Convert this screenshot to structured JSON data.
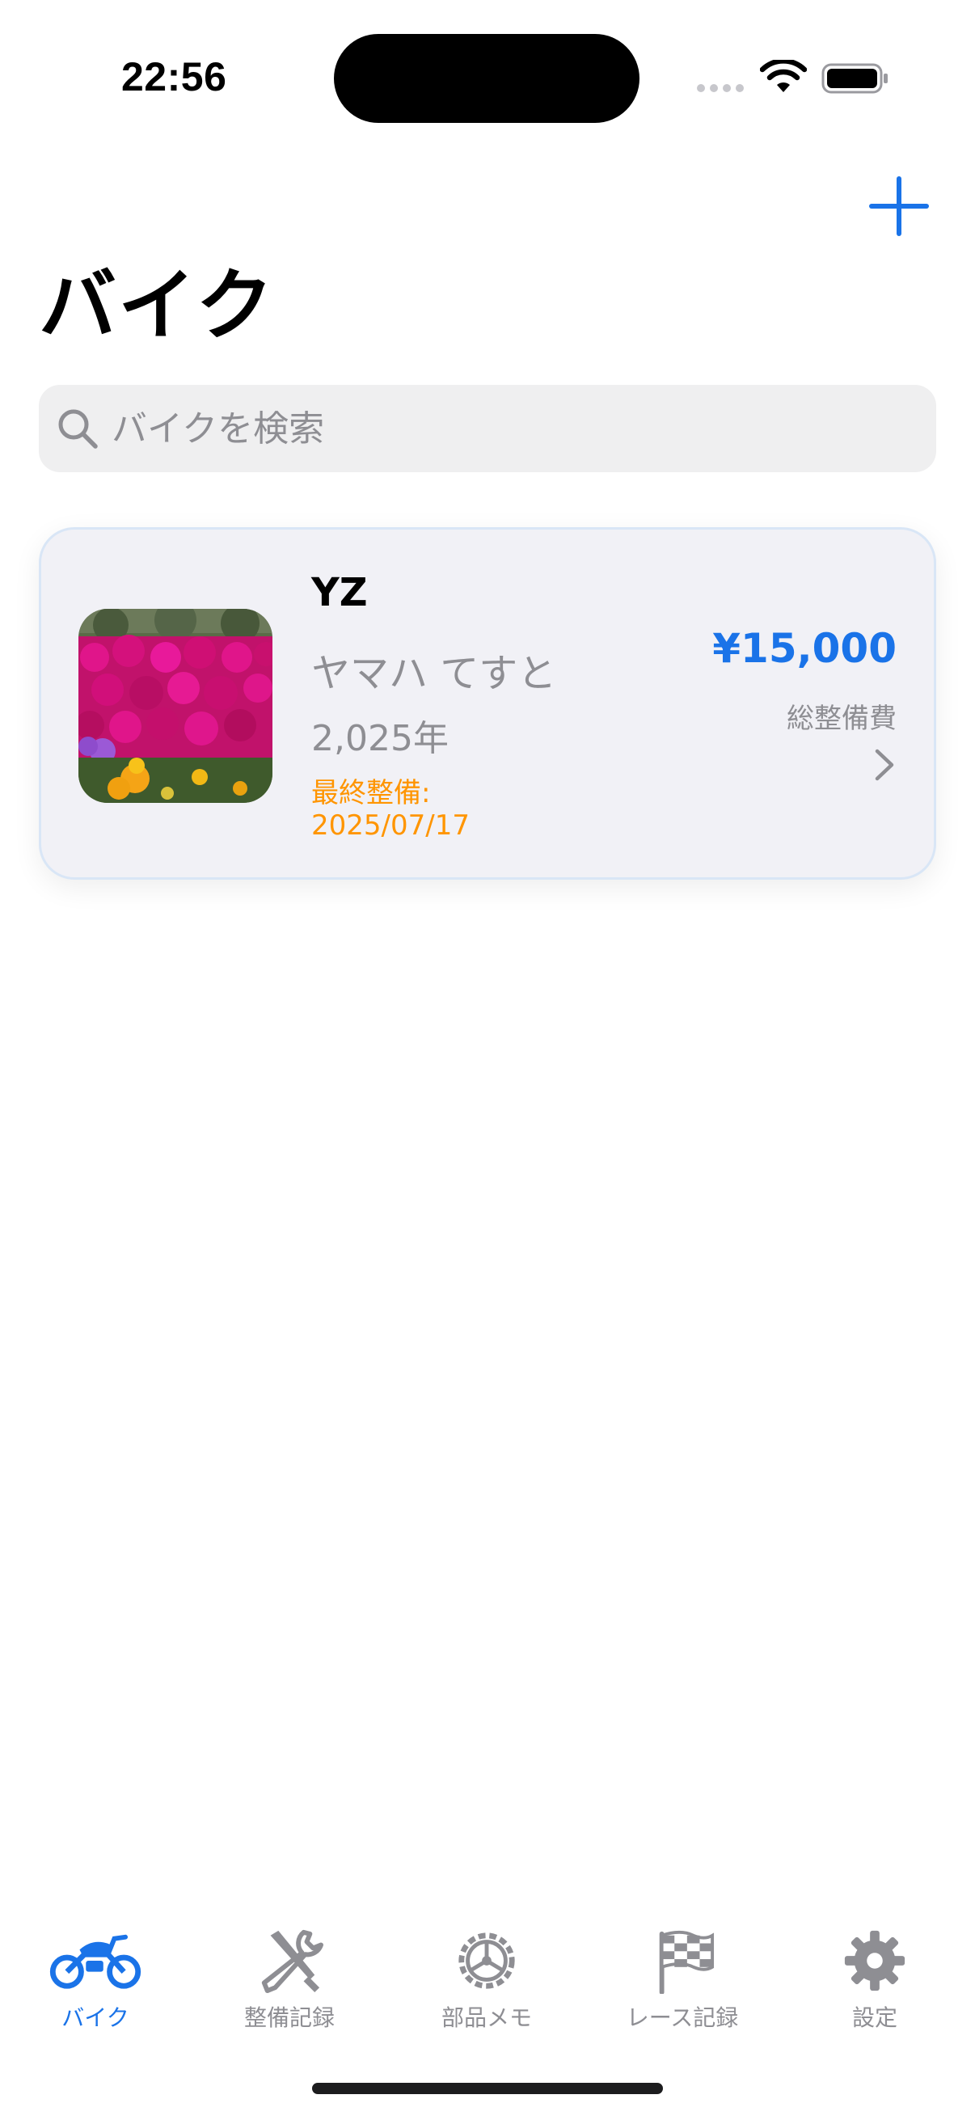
{
  "status_bar": {
    "time": "22:56"
  },
  "nav": {
    "title": "バイク"
  },
  "search": {
    "placeholder": "バイクを検索",
    "value": ""
  },
  "bikes": [
    {
      "name": "YZ",
      "maker_model": "ヤマハ てすと",
      "year": "2,025年",
      "last_maintenance_label": "最終整備:",
      "last_maintenance_date": "2025/07/17",
      "total_cost": "¥15,000",
      "total_cost_label": "総整備費"
    }
  ],
  "tabs": [
    {
      "label": "バイク",
      "icon": "motorcycle-icon",
      "active": true
    },
    {
      "label": "整備記録",
      "icon": "wrench-screwdriver-icon",
      "active": false
    },
    {
      "label": "部品メモ",
      "icon": "gear-wheel-icon",
      "active": false
    },
    {
      "label": "レース記録",
      "icon": "checkered-flag-icon",
      "active": false
    },
    {
      "label": "設定",
      "icon": "settings-gear-icon",
      "active": false
    }
  ],
  "colors": {
    "accent": "#1a73e8",
    "warning": "#ff9500",
    "secondary_text": "#8e8e93",
    "card_background": "#f1f1f6"
  }
}
